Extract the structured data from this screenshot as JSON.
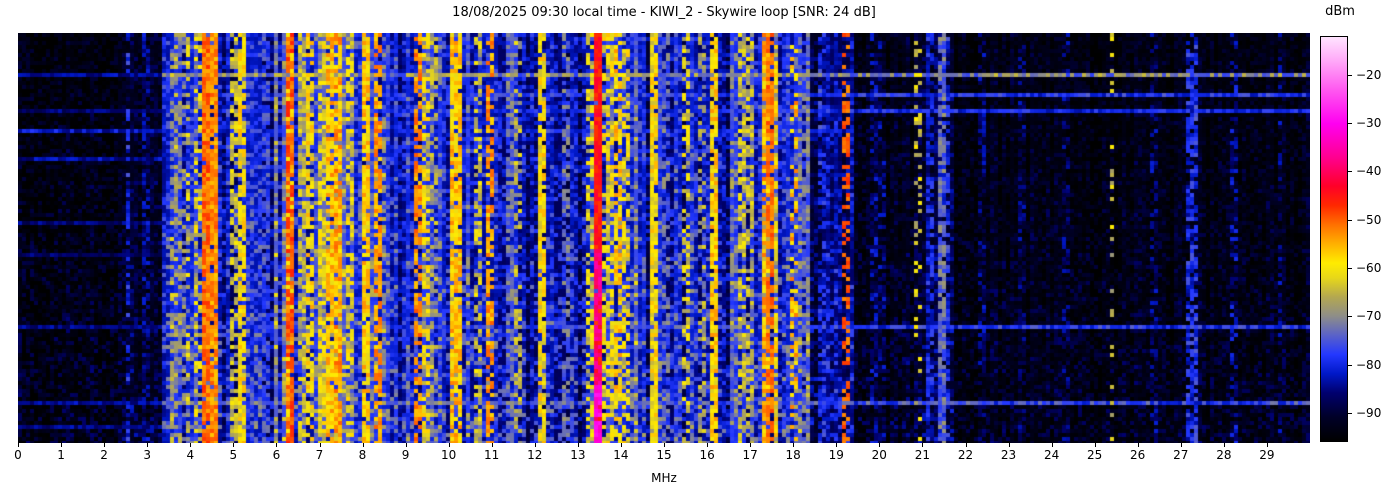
{
  "chart_data": {
    "type": "heatmap",
    "subtype": "radio-spectrum-waterfall",
    "title": "18/08/2025 09:30 local time - KIWI_2 - Skywire loop [SNR: 24 dB]",
    "station": "KIWI_2",
    "antenna": "Skywire loop",
    "snr_db": 24,
    "timestamp_label": "18/08/2025 09:30 local time",
    "xlabel": "MHz",
    "colorbar_label": "dBm",
    "x_range": [
      0,
      30
    ],
    "x_ticks": [
      0,
      1,
      2,
      3,
      4,
      5,
      6,
      7,
      8,
      9,
      10,
      11,
      12,
      13,
      14,
      15,
      16,
      17,
      18,
      19,
      20,
      21,
      22,
      23,
      24,
      25,
      26,
      27,
      28,
      29
    ],
    "grid": false,
    "legend": "none",
    "colorbar": {
      "min": -96,
      "max": -12,
      "tick_values": [
        -20,
        -30,
        -40,
        -50,
        -60,
        -70,
        -80,
        -90
      ],
      "tick_labels": [
        "−20",
        "−30",
        "−40",
        "−50",
        "−60",
        "−70",
        "−80",
        "−90"
      ],
      "stops": [
        {
          "v": -96,
          "c": "#000000"
        },
        {
          "v": -91,
          "c": "#000028"
        },
        {
          "v": -86,
          "c": "#00006e"
        },
        {
          "v": -82,
          "c": "#0018c8"
        },
        {
          "v": -78,
          "c": "#2438ff"
        },
        {
          "v": -74,
          "c": "#5a62c8"
        },
        {
          "v": -70,
          "c": "#8e8e88"
        },
        {
          "v": -66,
          "c": "#b4a850"
        },
        {
          "v": -62,
          "c": "#e8d818"
        },
        {
          "v": -59,
          "c": "#ffec00"
        },
        {
          "v": -55,
          "c": "#ffb000"
        },
        {
          "v": -51,
          "c": "#ff7000"
        },
        {
          "v": -47,
          "c": "#ff2800"
        },
        {
          "v": -43,
          "c": "#ff0028"
        },
        {
          "v": -37,
          "c": "#ff0090"
        },
        {
          "v": -30,
          "c": "#ff00f0"
        },
        {
          "v": -23,
          "c": "#ff58f0"
        },
        {
          "v": -17,
          "c": "#ffa8f8"
        },
        {
          "v": -12,
          "c": "#ffe4ff"
        }
      ]
    },
    "noise_regions": [
      {
        "f0": 0.0,
        "f1": 2.45,
        "base": -94,
        "cv": 1.5,
        "spark": 8
      },
      {
        "f0": 2.45,
        "f1": 3.35,
        "base": -92.5,
        "cv": 2,
        "spark": 9
      },
      {
        "f0": 3.35,
        "f1": 4.6,
        "base": -81,
        "cv": 5,
        "spark": 13
      },
      {
        "f0": 4.6,
        "f1": 5.9,
        "base": -84,
        "cv": 5,
        "spark": 12
      },
      {
        "f0": 5.9,
        "f1": 6.5,
        "base": -79,
        "cv": 6,
        "spark": 14
      },
      {
        "f0": 6.5,
        "f1": 7.6,
        "base": -77,
        "cv": 7,
        "spark": 15
      },
      {
        "f0": 7.6,
        "f1": 8.5,
        "base": -81,
        "cv": 6,
        "spark": 13
      },
      {
        "f0": 8.5,
        "f1": 9.3,
        "base": -83,
        "cv": 5,
        "spark": 12
      },
      {
        "f0": 9.3,
        "f1": 10.5,
        "base": -81,
        "cv": 6,
        "spark": 13
      },
      {
        "f0": 10.5,
        "f1": 11.8,
        "base": -84,
        "cv": 5,
        "spark": 12
      },
      {
        "f0": 11.8,
        "f1": 13.3,
        "base": -85,
        "cv": 5,
        "spark": 12
      },
      {
        "f0": 13.3,
        "f1": 14.4,
        "base": -79,
        "cv": 6,
        "spark": 14
      },
      {
        "f0": 14.4,
        "f1": 16.5,
        "base": -84,
        "cv": 5,
        "spark": 12
      },
      {
        "f0": 16.5,
        "f1": 18.35,
        "base": -81,
        "cv": 6,
        "spark": 13
      },
      {
        "f0": 18.35,
        "f1": 19.45,
        "base": -87,
        "cv": 4,
        "spark": 10
      },
      {
        "f0": 19.45,
        "f1": 21.0,
        "base": -92.5,
        "cv": 2,
        "spark": 8
      },
      {
        "f0": 21.0,
        "f1": 21.7,
        "base": -89,
        "cv": 3,
        "spark": 9
      },
      {
        "f0": 21.7,
        "f1": 30.1,
        "base": -93.5,
        "cv": 1.8,
        "spark": 7
      }
    ],
    "signal_lines": [
      {
        "f": 2.55,
        "lv": -80,
        "w": 0.05,
        "d": 0.55
      },
      {
        "f": 3.0,
        "lv": -85,
        "w": 0.05,
        "d": 0.5
      },
      {
        "f": 3.62,
        "lv": -67,
        "w": 0.05,
        "d": 0.35
      },
      {
        "f": 3.8,
        "lv": -69,
        "w": 0.04,
        "d": 0.35
      },
      {
        "f": 3.95,
        "lv": -64,
        "w": 0.05,
        "d": 0.4
      },
      {
        "f": 4.15,
        "lv": -63,
        "w": 0.05,
        "d": 0.45
      },
      {
        "f": 4.33,
        "lv": -51,
        "w": 0.07,
        "d": 0.95,
        "j": 4
      },
      {
        "f": 4.58,
        "lv": -53,
        "w": 0.05,
        "d": 0.9,
        "j": 4
      },
      {
        "f": 5.0,
        "lv": -64,
        "w": 0.06,
        "d": 0.55
      },
      {
        "f": 5.18,
        "lv": -60,
        "w": 0.06,
        "d": 0.8
      },
      {
        "f": 5.75,
        "lv": -77,
        "w": 0.1,
        "d": 0.7
      },
      {
        "f": 6.3,
        "lv": -56,
        "w": 0.12,
        "d": 0.85
      },
      {
        "f": 6.33,
        "lv": -49,
        "w": 0.04,
        "d": 0.7,
        "j": 3
      },
      {
        "f": 6.6,
        "lv": -65,
        "w": 0.05,
        "d": 0.5
      },
      {
        "f": 6.8,
        "lv": -59,
        "w": 0.05,
        "d": 0.6
      },
      {
        "f": 7.05,
        "lv": -62,
        "w": 0.08,
        "d": 0.6
      },
      {
        "f": 7.25,
        "lv": -57,
        "w": 0.12,
        "d": 0.8
      },
      {
        "f": 7.4,
        "lv": -55,
        "w": 0.1,
        "d": 0.8
      },
      {
        "f": 7.7,
        "lv": -62,
        "w": 0.06,
        "d": 0.6
      },
      {
        "f": 8.1,
        "lv": -58,
        "w": 0.06,
        "d": 0.85
      },
      {
        "f": 8.32,
        "lv": -54,
        "w": 0.04,
        "d": 0.7,
        "j": 4
      },
      {
        "f": 8.5,
        "lv": -67,
        "w": 0.05,
        "d": 0.4
      },
      {
        "f": 9.26,
        "lv": -53,
        "w": 0.04,
        "d": 0.6,
        "j": 4
      },
      {
        "f": 9.45,
        "lv": -61,
        "w": 0.06,
        "d": 0.6
      },
      {
        "f": 9.7,
        "lv": -67,
        "w": 0.05,
        "d": 0.4
      },
      {
        "f": 10.15,
        "lv": -57,
        "w": 0.22,
        "d": 0.85
      },
      {
        "f": 10.65,
        "lv": -64,
        "w": 0.05,
        "d": 0.5
      },
      {
        "f": 10.95,
        "lv": -54,
        "w": 0.04,
        "d": 0.6,
        "j": 4
      },
      {
        "f": 11.4,
        "lv": -73,
        "w": 0.05,
        "d": 0.7
      },
      {
        "f": 11.62,
        "lv": -66,
        "w": 0.04,
        "d": 0.4
      },
      {
        "f": 12.14,
        "lv": -60,
        "w": 0.05,
        "d": 0.8
      },
      {
        "f": 12.7,
        "lv": -73,
        "w": 0.05,
        "d": 0.6
      },
      {
        "f": 13.28,
        "lv": -63,
        "w": 0.05,
        "d": 0.5
      },
      {
        "f": 13.45,
        "lv": -45,
        "w": 0.06,
        "d": 0.95,
        "j": 3,
        "hot": [
          {
            "t0": 0.52,
            "t1": 1.0,
            "lv": -38
          },
          {
            "t0": 0.86,
            "t1": 1.0,
            "lv": -31
          }
        ]
      },
      {
        "f": 13.72,
        "lv": -61,
        "w": 0.15,
        "d": 0.55
      },
      {
        "f": 13.95,
        "lv": -58,
        "w": 0.12,
        "d": 0.6
      },
      {
        "f": 14.12,
        "lv": -61,
        "w": 0.08,
        "d": 0.5
      },
      {
        "f": 14.8,
        "lv": -60,
        "w": 0.05,
        "d": 0.9
      },
      {
        "f": 15.05,
        "lv": -73,
        "w": 0.05,
        "d": 0.5
      },
      {
        "f": 15.5,
        "lv": -63,
        "w": 0.05,
        "d": 0.5
      },
      {
        "f": 15.85,
        "lv": -67,
        "w": 0.04,
        "d": 0.4
      },
      {
        "f": 16.2,
        "lv": -58,
        "w": 0.05,
        "d": 0.8
      },
      {
        "f": 16.8,
        "lv": -64,
        "w": 0.05,
        "d": 0.55
      },
      {
        "f": 17.0,
        "lv": -65,
        "w": 0.04,
        "d": 0.5
      },
      {
        "f": 17.35,
        "lv": -56,
        "w": 0.12,
        "d": 0.8
      },
      {
        "f": 17.42,
        "lv": -51,
        "w": 0.04,
        "d": 0.7,
        "j": 3
      },
      {
        "f": 17.6,
        "lv": -60,
        "w": 0.05,
        "d": 0.7
      },
      {
        "f": 18.05,
        "lv": -56,
        "w": 0.05,
        "d": 0.35
      },
      {
        "f": 18.3,
        "lv": -73,
        "w": 0.04,
        "d": 0.6
      },
      {
        "f": 18.7,
        "lv": -79,
        "w": 0.05,
        "d": 0.5
      },
      {
        "f": 19.24,
        "lv": -50,
        "w": 0.09,
        "d": 0.45,
        "j": 3
      },
      {
        "f": 19.85,
        "lv": -85,
        "w": 0.1,
        "d": 0.5
      },
      {
        "f": 20.1,
        "lv": -86,
        "w": 0.06,
        "d": 0.4
      },
      {
        "f": 20.9,
        "lv": -63,
        "w": 0.03,
        "d": 0.22
      },
      {
        "f": 21.2,
        "lv": -81,
        "w": 0.12,
        "d": 0.6
      },
      {
        "f": 21.45,
        "lv": -73,
        "w": 0.06,
        "d": 0.8
      },
      {
        "f": 21.58,
        "lv": -79,
        "w": 0.05,
        "d": 0.6
      },
      {
        "f": 22.4,
        "lv": -86,
        "w": 0.04,
        "d": 0.5
      },
      {
        "f": 23.3,
        "lv": -87,
        "w": 0.04,
        "d": 0.4
      },
      {
        "f": 24.3,
        "lv": -87,
        "w": 0.04,
        "d": 0.4
      },
      {
        "f": 25.4,
        "lv": -64,
        "w": 0.03,
        "d": 0.25
      },
      {
        "f": 26.4,
        "lv": -86,
        "w": 0.04,
        "d": 0.4
      },
      {
        "f": 27.2,
        "lv": -80,
        "w": 0.04,
        "d": 0.75
      },
      {
        "f": 27.35,
        "lv": -79,
        "w": 0.04,
        "d": 0.7
      },
      {
        "f": 28.2,
        "lv": -84,
        "w": 0.04,
        "d": 0.5
      },
      {
        "f": 29.3,
        "lv": -86,
        "w": 0.04,
        "d": 0.4
      }
    ],
    "time_streaks": [
      {
        "t": 0.102,
        "lv": -84,
        "f0": 0,
        "f1": 3.3,
        "j": 3
      },
      {
        "t": 0.102,
        "lv": -71,
        "f0": 3.3,
        "f1": 30,
        "j": 7
      },
      {
        "t": 0.151,
        "lv": -79,
        "f0": 3.3,
        "f1": 30,
        "j": 5
      },
      {
        "t": 0.185,
        "lv": -86,
        "f0": 0,
        "f1": 3.3,
        "j": 3
      },
      {
        "t": 0.185,
        "lv": -80,
        "f0": 3.3,
        "f1": 30,
        "j": 4
      },
      {
        "t": 0.232,
        "lv": -82,
        "f0": 0,
        "f1": 19.4,
        "j": 4
      },
      {
        "t": 0.3,
        "lv": -84,
        "f0": 0,
        "f1": 16,
        "j": 4
      },
      {
        "t": 0.456,
        "lv": -86,
        "f0": 0,
        "f1": 6.5,
        "j": 3
      },
      {
        "t": 0.54,
        "lv": -87,
        "f0": 0,
        "f1": 4,
        "j": 3
      },
      {
        "t": 0.72,
        "lv": -85,
        "f0": 0,
        "f1": 3.3,
        "j": 3
      },
      {
        "t": 0.72,
        "lv": -79,
        "f0": 3.3,
        "f1": 30,
        "j": 5
      },
      {
        "t": 0.9,
        "lv": -84,
        "f0": 0,
        "f1": 3.3,
        "j": 3
      },
      {
        "t": 0.9,
        "lv": -77,
        "f0": 3.3,
        "f1": 30,
        "j": 6
      },
      {
        "t": 0.963,
        "lv": -85,
        "f0": 0,
        "f1": 5,
        "j": 3
      }
    ]
  }
}
